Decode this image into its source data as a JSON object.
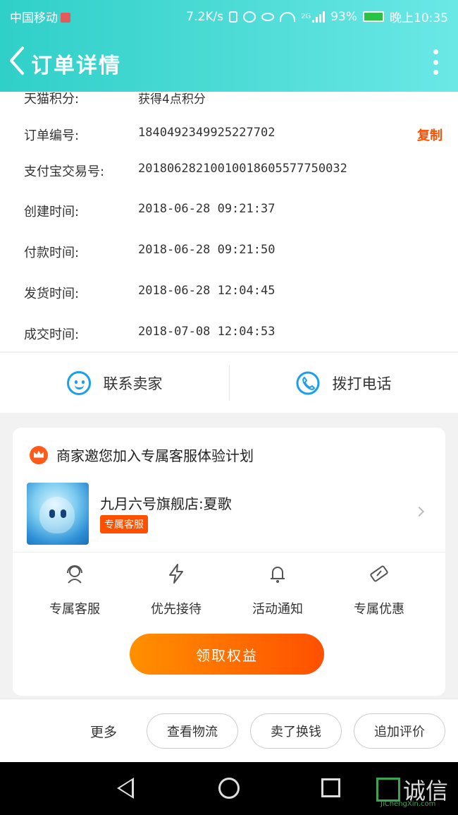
{
  "status_bar": {
    "carrier": "中国移动",
    "speed": "7.2K/s",
    "network": "2G",
    "battery": "93%",
    "time": "晚上10:35"
  },
  "header": {
    "title": "订单详情"
  },
  "order": {
    "rows": [
      {
        "label": "天猫积分:",
        "value": "获得4点积分"
      },
      {
        "label": "订单编号:",
        "value": "1840492349925227702"
      },
      {
        "label": "支付宝交易号:",
        "value": "20180628210010018605577750032"
      },
      {
        "label": "创建时间:",
        "value": "2018-06-28 09:21:37"
      },
      {
        "label": "付款时间:",
        "value": "2018-06-28 09:21:50"
      },
      {
        "label": "发货时间:",
        "value": "2018-06-28 12:04:45"
      },
      {
        "label": "成交时间:",
        "value": "2018-07-08 12:04:53"
      }
    ],
    "copy_label": "复制"
  },
  "contact": {
    "seller": "联系卖家",
    "phone": "拨打电话"
  },
  "promo": {
    "title": "商家邀您加入专属客服体验计划",
    "shop_name": "九月六号旗舰店:夏歌",
    "shop_tag": "专属客服",
    "perks": [
      "专属客服",
      "优先接待",
      "活动通知",
      "专属优惠"
    ],
    "claim_label": "领取权益"
  },
  "actions": {
    "more": "更多",
    "logistics": "查看物流",
    "resell": "卖了换钱",
    "review": "追加评价"
  },
  "watermark": {
    "text": "诚信",
    "sub": "JiChengXin.com"
  },
  "colors": {
    "header_start": "#2fd0c8",
    "header_end": "#6ae8e6",
    "accent": "#ff5000",
    "icon_blue": "#1a9ff0"
  }
}
